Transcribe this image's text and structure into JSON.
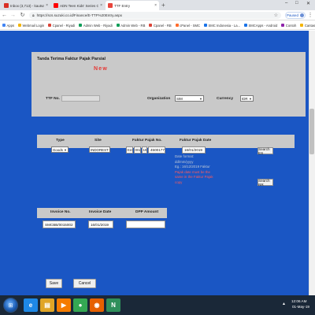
{
  "browser": {
    "tabs": [
      {
        "label": "Inbox (3,713) - kautsardiawan@gm",
        "favicon_color": "#d93025",
        "active": false
      },
      {
        "label": "ADN Teen Kids' Series Completi",
        "favicon_color": "#ff0000",
        "active": false
      },
      {
        "label": "TTF Entry",
        "favicon_color": "#e8453c",
        "active": true
      }
    ],
    "new_tab_symbol": "+",
    "window_controls": {
      "minimize": "–",
      "maximize": "□",
      "close": "✕"
    },
    "address": "https://scs.suzuki.co.id/Finance/E-TTF%20Entry.aspx",
    "profile_badge": "Paused",
    "bookmarks": [
      {
        "label": "Apps",
        "color": "#4285f4"
      },
      {
        "label": "Webmail Login",
        "color": "#f4b400"
      },
      {
        "label": "Cpanel - Riyadi",
        "color": "#db4437"
      },
      {
        "label": "Admin Web - Riyadi",
        "color": "#0f9d58"
      },
      {
        "label": "Admin Web - RB",
        "color": "#0f9d58"
      },
      {
        "label": "Cpanel - RB",
        "color": "#db4437"
      },
      {
        "label": "cPanel - SMC",
        "color": "#ff6c2c"
      },
      {
        "label": "SMC Indonesia - La...",
        "color": "#1a73e8"
      },
      {
        "label": "SMCApps - Android",
        "color": "#1a73e8"
      },
      {
        "label": "Contoh",
        "color": "#8e24aa"
      },
      {
        "label": "Cantasia 8 Fullrea",
        "color": "#f4b400"
      }
    ]
  },
  "form": {
    "title": "Tanda Terima Faktur Pajak Parsial",
    "mode": "New",
    "ttf_no_label": "TTF No.",
    "ttf_no_value": "",
    "organization_label": "Organization",
    "organization_value": "SIM",
    "currency_label": "Currency",
    "currency_value": "IDR"
  },
  "tax_invoice": {
    "headers": {
      "type": "Type",
      "site": "Site",
      "faktur_no": "Faktur Pajak No.",
      "faktur_date": "Faktur Pajak Date"
    },
    "type_value": "Goods",
    "site_value": "INDOREST",
    "faktur_no_parts": [
      "010",
      "002",
      "19",
      "45001779"
    ],
    "faktur_date_value": "16/01/2019",
    "search_es_label": "Search ES",
    "search_rr_label": "Search RR",
    "date_help": [
      {
        "text": "Date format:",
        "warning": false
      },
      {
        "text": "dd/mm/yyyy",
        "warning": false
      },
      {
        "text": "Eg.: 16/12/2019 Faktur",
        "warning": false
      },
      {
        "text": "Pajak date must be the",
        "warning": true
      },
      {
        "text": "same in the Faktur Pajak",
        "warning": true
      },
      {
        "text": "copy",
        "warning": true
      }
    ]
  },
  "invoice": {
    "headers": {
      "invoice_no": "Invoice No.",
      "invoice_date": "Invoice Date",
      "dpp_amount": "DPP Amount"
    },
    "invoice_no_value": "SMCBB/0015002",
    "invoice_date_value": "16/01/2019",
    "dpp_amount_value": ""
  },
  "actions": {
    "save": "Save",
    "cancel": "Cancel"
  },
  "taskbar": {
    "apps": [
      {
        "name": "internet-explorer",
        "glyph": "e",
        "color": "#1e88e5"
      },
      {
        "name": "file-explorer",
        "glyph": "▤",
        "color": "#e0a526"
      },
      {
        "name": "media-player",
        "glyph": "▶",
        "color": "#f57c00"
      },
      {
        "name": "chrome",
        "glyph": "●",
        "color": "#34a853"
      },
      {
        "name": "firefox",
        "glyph": "◉",
        "color": "#e66000"
      },
      {
        "name": "navicat",
        "glyph": "N",
        "color": "#2f8f5b"
      }
    ],
    "clock_time": "12:06 AM",
    "clock_date": "01-May-19"
  }
}
